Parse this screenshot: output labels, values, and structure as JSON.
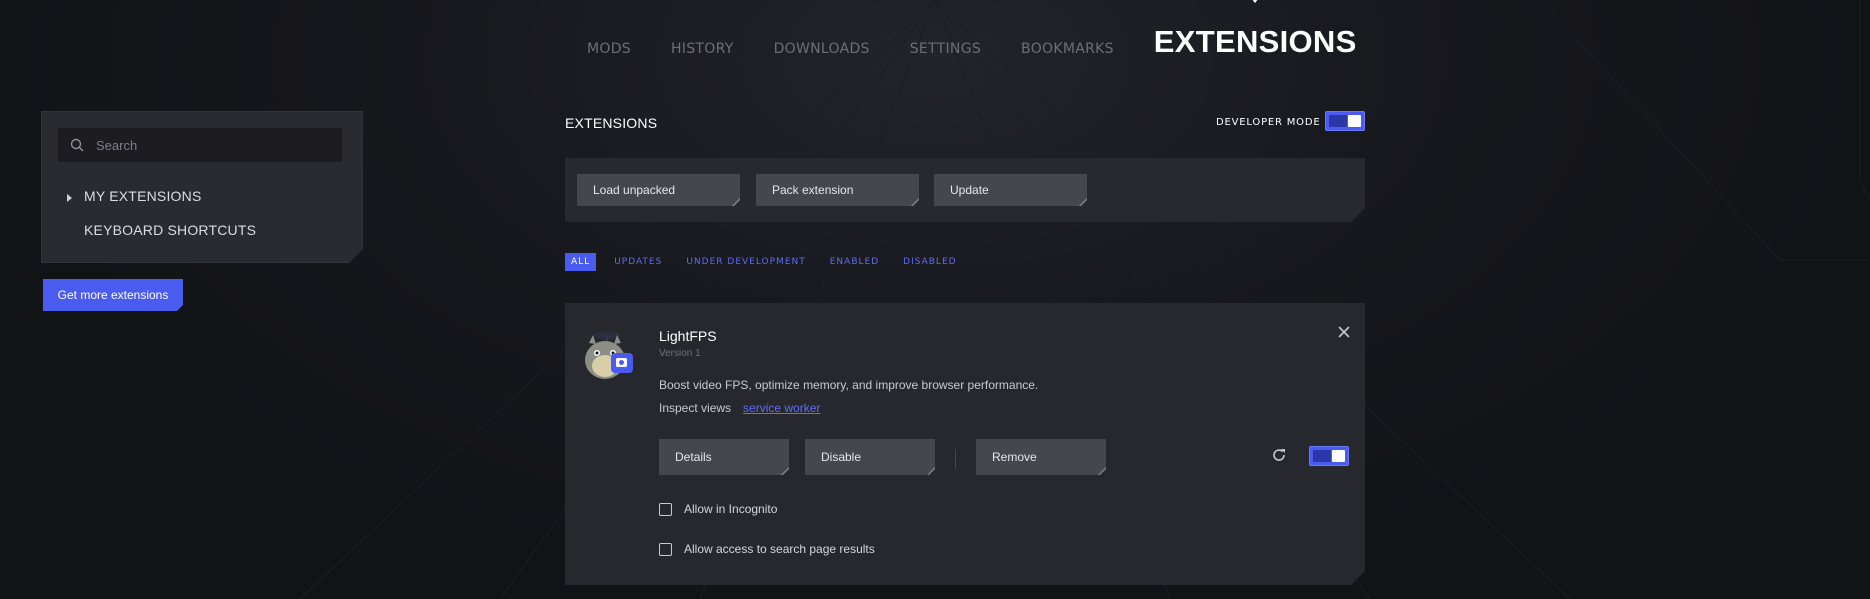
{
  "nav": {
    "items": [
      "MODS",
      "HISTORY",
      "DOWNLOADS",
      "SETTINGS",
      "BOOKMARKS"
    ],
    "active": "EXTENSIONS"
  },
  "sidebar": {
    "search_placeholder": "Search",
    "items": [
      {
        "label": "MY EXTENSIONS"
      },
      {
        "label": "KEYBOARD SHORTCUTS"
      }
    ],
    "get_more_label": "Get more extensions"
  },
  "main": {
    "title": "EXTENSIONS",
    "developer_mode_label": "DEVELOPER MODE",
    "developer_mode_on": true,
    "actions": {
      "load_unpacked": "Load unpacked",
      "pack_extension": "Pack extension",
      "update": "Update"
    },
    "filters": [
      "ALL",
      "UPDATES",
      "UNDER DEVELOPMENT",
      "ENABLED",
      "DISABLED"
    ],
    "active_filter": "ALL"
  },
  "extension": {
    "name": "LightFPS",
    "version": "Version 1",
    "description": "Boost video FPS, optimize memory, and improve browser performance.",
    "inspect_label": "Inspect views",
    "inspect_link": "service worker",
    "buttons": {
      "details": "Details",
      "disable": "Disable",
      "remove": "Remove"
    },
    "enabled": true,
    "allow_incognito": "Allow in Incognito",
    "allow_search": "Allow access to search page results"
  },
  "colors": {
    "accent": "#4a5cf0",
    "background": "#121317",
    "panel": "#27272e"
  }
}
